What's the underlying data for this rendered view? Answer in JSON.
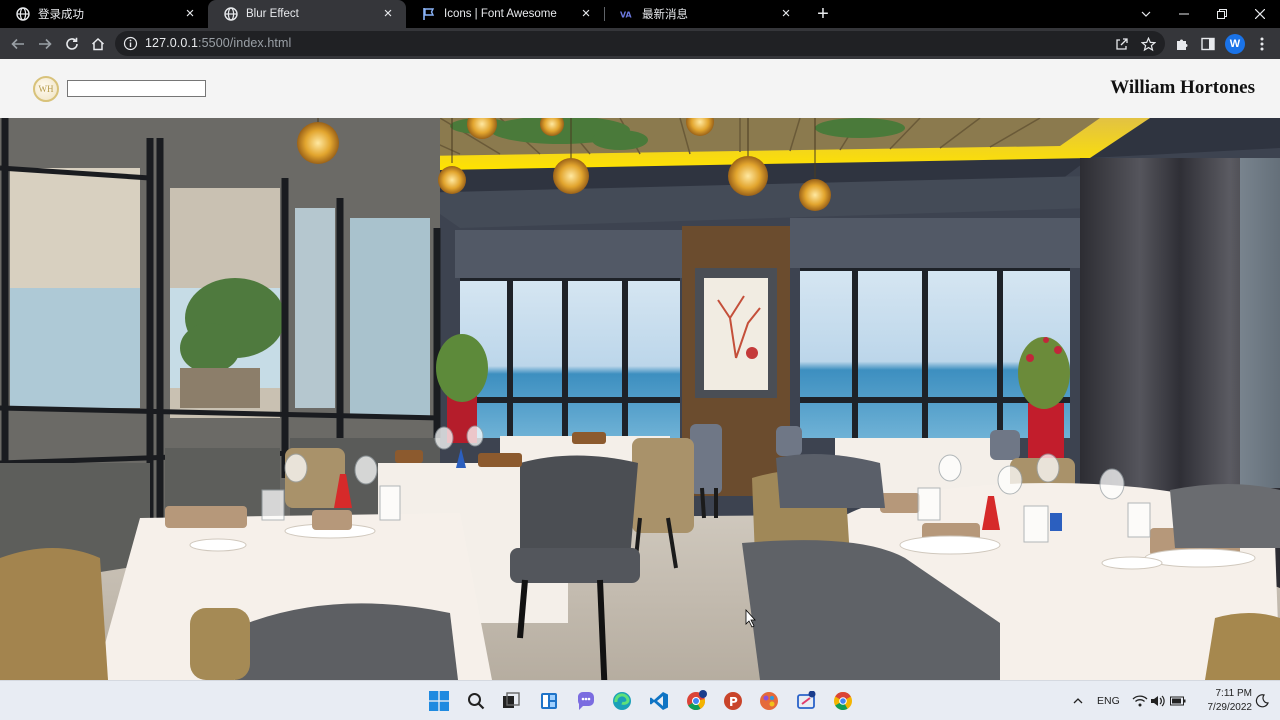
{
  "browser": {
    "tabs": [
      {
        "title": "登录成功",
        "active": false
      },
      {
        "title": "Blur Effect",
        "active": true
      },
      {
        "title": "Icons | Font Awesome",
        "active": false
      },
      {
        "title": "最新消息",
        "active": false
      }
    ],
    "new_tab_label": "+",
    "url_host": "127.0.0.1",
    "url_rest": ":5500/index.html",
    "profile_initial": "W"
  },
  "site": {
    "logo_text": "WH",
    "search_value": "",
    "name": "William Hortones"
  },
  "taskbar": {
    "language": "ENG",
    "time": "7:11 PM",
    "date": "7/29/2022"
  }
}
